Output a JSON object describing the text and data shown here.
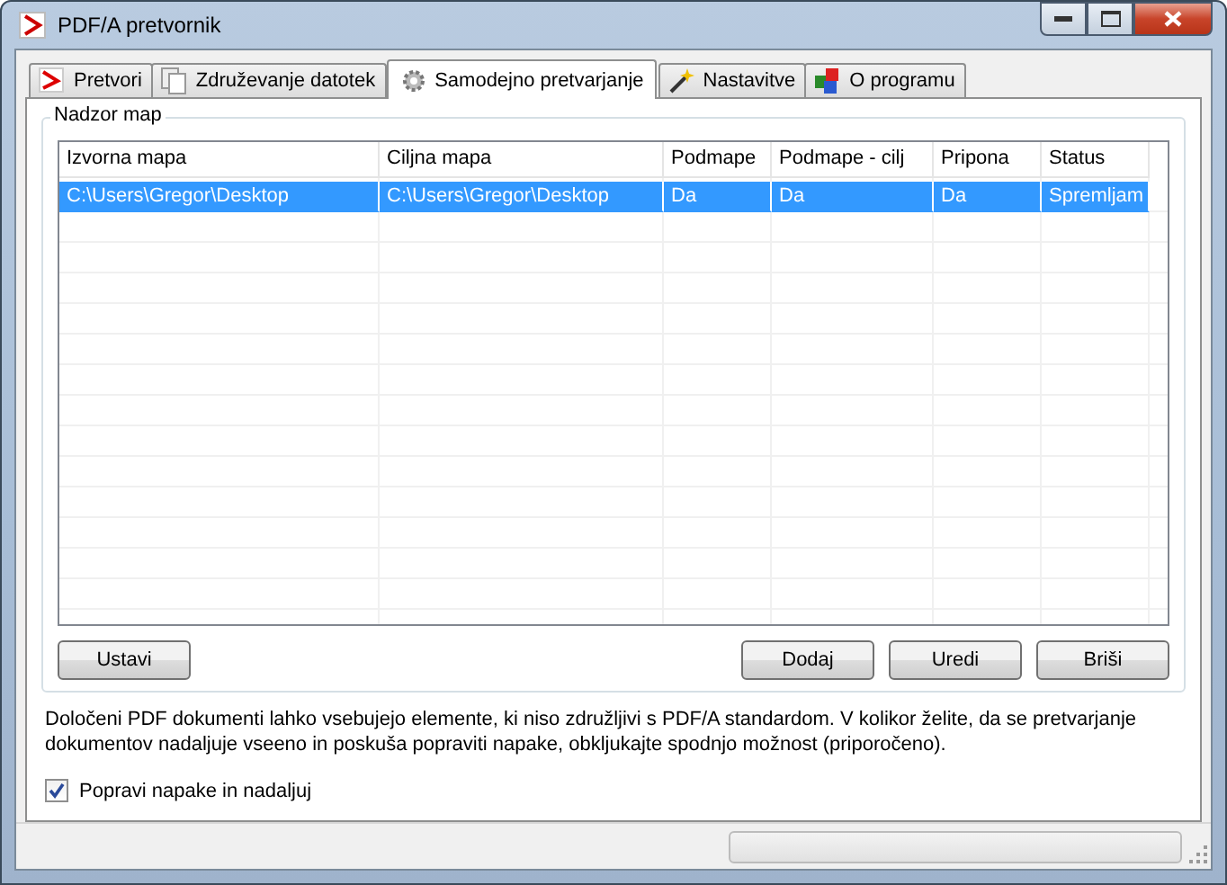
{
  "window": {
    "title": "PDF/A pretvornik"
  },
  "tabs": [
    {
      "label": "Pretvori",
      "selected": false
    },
    {
      "label": "Združevanje datotek",
      "selected": false
    },
    {
      "label": "Samodejno pretvarjanje",
      "selected": true
    },
    {
      "label": "Nastavitve",
      "selected": false
    },
    {
      "label": "O programu",
      "selected": false
    }
  ],
  "group": {
    "title": "Nadzor map"
  },
  "table": {
    "columns": [
      "Izvorna mapa",
      "Ciljna mapa",
      "Podmape",
      "Podmape - cilj",
      "Pripona",
      "Status"
    ],
    "rows": [
      {
        "cells": [
          "C:\\Users\\Gregor\\Desktop",
          "C:\\Users\\Gregor\\Desktop",
          "Da",
          "Da",
          "Da",
          "Spremljam"
        ],
        "selected": true
      }
    ]
  },
  "buttons_left": [
    "Ustavi"
  ],
  "buttons_right": [
    "Dodaj",
    "Uredi",
    "Briši"
  ],
  "note": "Določeni PDF dokumenti lahko vsebujejo elemente, ki niso združljivi s PDF/A standardom. V kolikor želite, da se pretvarjanje dokumentov nadaljuje vseeno in poskuša popraviti napake, obkljukajte spodnjo možnost (priporočeno).",
  "checkbox": {
    "label": "Popravi napake in nadaljuj",
    "checked": true
  },
  "status_bar": {
    "progress": {
      "level": 0
    }
  }
}
